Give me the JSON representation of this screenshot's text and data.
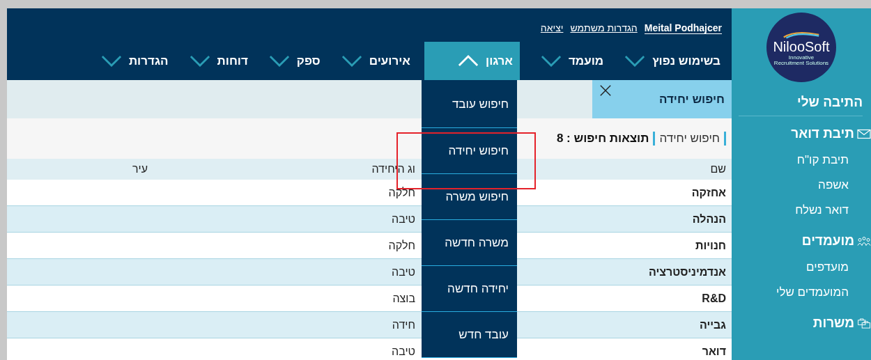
{
  "user": {
    "name": "Meital Podhajcer",
    "links": [
      "הגדרות משתמש",
      "יציאה"
    ]
  },
  "logo": {
    "name": "NilooSoft",
    "tagline": "Innovative Recruitment Solutions"
  },
  "nav": [
    {
      "label": "בשימוש נפוץ",
      "selected": false
    },
    {
      "label": "מועמד",
      "selected": false
    },
    {
      "label": "ארגון",
      "selected": true
    },
    {
      "label": "אירועים",
      "selected": false
    },
    {
      "label": "ספק",
      "selected": false
    },
    {
      "label": "דוחות",
      "selected": false
    },
    {
      "label": "הגדרות",
      "selected": false
    }
  ],
  "open_tabs": [
    {
      "label": "חיפוש יחידה",
      "selected": true
    }
  ],
  "breadcrumb": [
    "חיפוש יחידה",
    "תוצאות חיפוש : 8"
  ],
  "dropdown": {
    "items": [
      {
        "label": "חיפוש עובד",
        "highlighted": false
      },
      {
        "label": "חיפוש יחידה",
        "highlighted": true
      },
      {
        "label": "חיפוש משרה",
        "highlighted": false
      },
      {
        "label": "משרה חדשה",
        "highlighted": false
      },
      {
        "label": "יחידה חדשה",
        "highlighted": false
      },
      {
        "label": "עובד חדש",
        "highlighted": false
      }
    ]
  },
  "table": {
    "columns": [
      "שם",
      "וג היחידה",
      "עיר"
    ],
    "rows": [
      [
        "אחזקה",
        "חלקה"
      ],
      [
        "הנהלה",
        "טיבה"
      ],
      [
        "חנויות",
        "חלקה"
      ],
      [
        "אנדמיניסטרציה",
        "טיבה"
      ],
      [
        "R&D",
        "בוצה"
      ],
      [
        "גבייה",
        "חידה"
      ],
      [
        "דואר",
        "טיבה"
      ]
    ]
  },
  "sidebar": {
    "title": "התיבה שלי",
    "sections": [
      {
        "label": "תיבת דואר",
        "items": [
          "תיבת קו\"ח",
          "אשפה",
          "דואר נשלח"
        ]
      },
      {
        "label": "מועמדים",
        "items": [
          "מועדפים",
          "המועמדים שלי"
        ]
      },
      {
        "label": "משרות"
      }
    ]
  }
}
